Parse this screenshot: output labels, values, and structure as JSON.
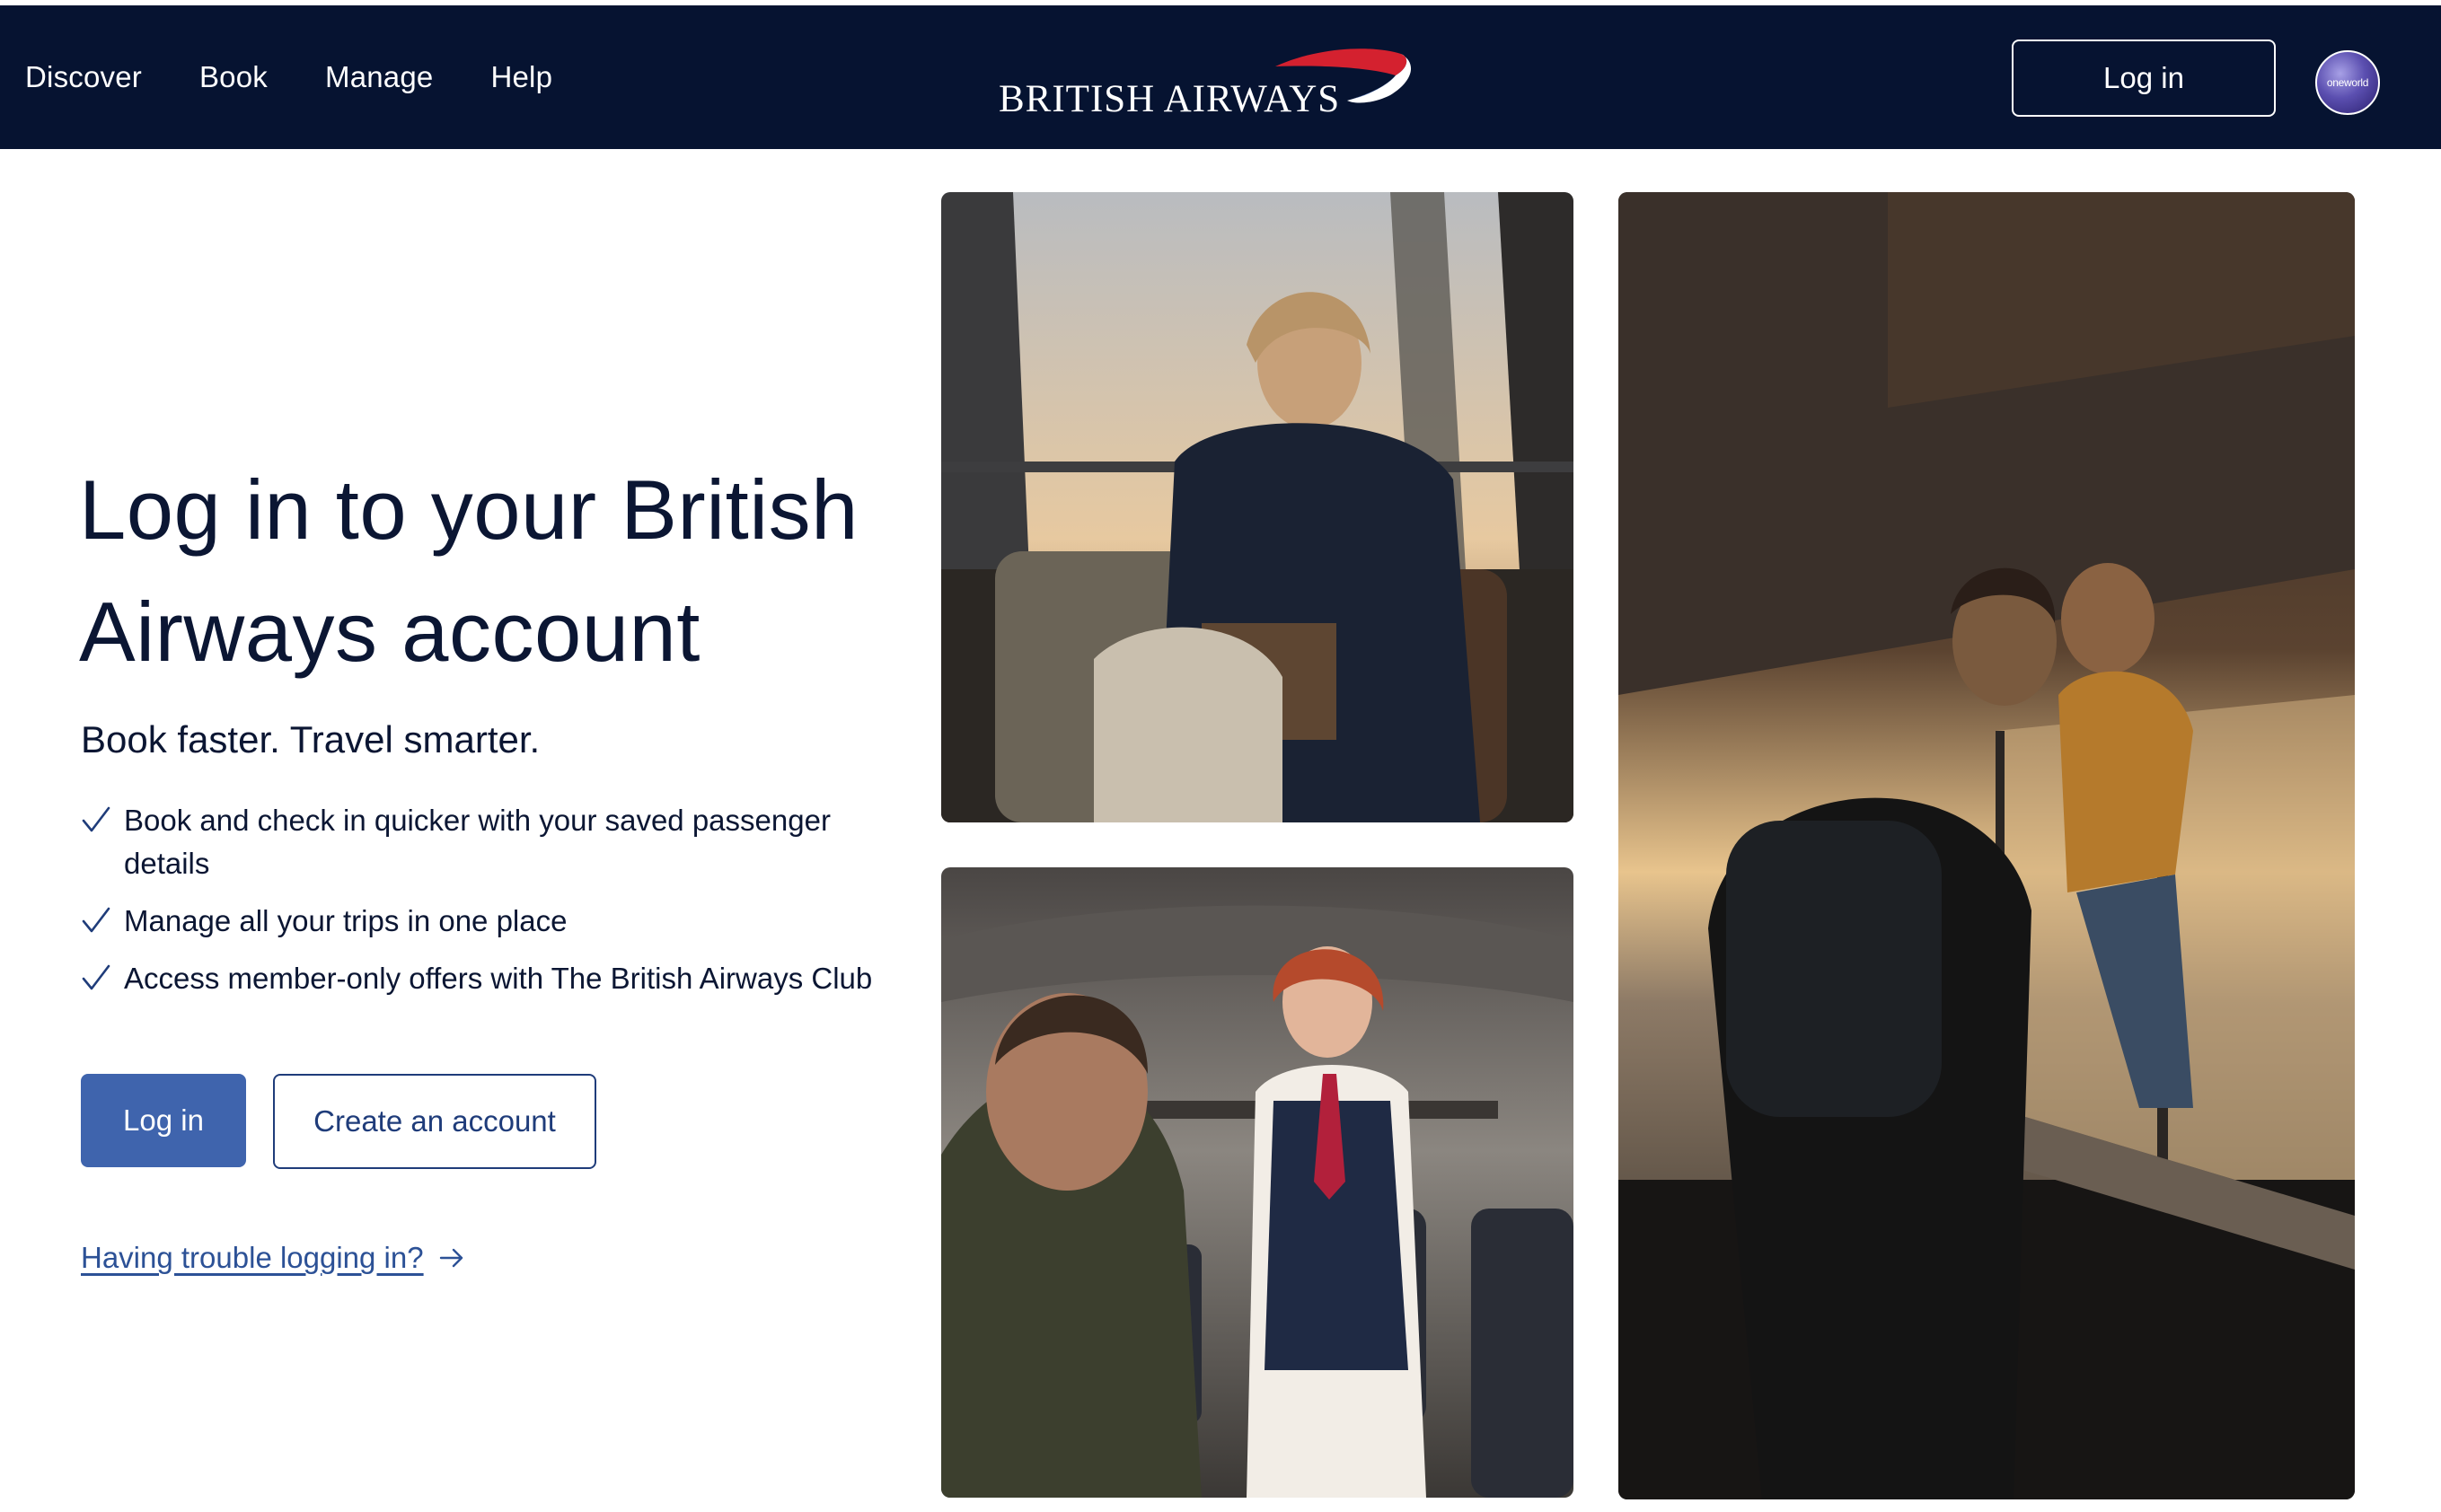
{
  "header": {
    "nav": [
      "Discover",
      "Book",
      "Manage",
      "Help"
    ],
    "logo_text": "BRITISH AIRWAYS",
    "login_label": "Log in",
    "alliance_badge": "oneworld"
  },
  "main": {
    "title": "Log in to your British Airways account",
    "subtitle": "Book faster. Travel smarter.",
    "benefits": [
      "Book and check in quicker with your saved passenger details",
      "Manage all your trips in one place",
      "Access member-only offers with The British Airways Club"
    ],
    "login_button": "Log in",
    "create_account_button": "Create an account",
    "trouble_link": "Having trouble logging in?"
  },
  "colors": {
    "header_bg": "#061331",
    "primary_button": "#3f64ad",
    "text": "#0b1633",
    "link": "#2c5196",
    "brand_red": "#d4212f"
  },
  "icons": [
    "check-icon",
    "arrow-right-icon",
    "ba-speedmarque-logo",
    "oneworld-badge"
  ]
}
